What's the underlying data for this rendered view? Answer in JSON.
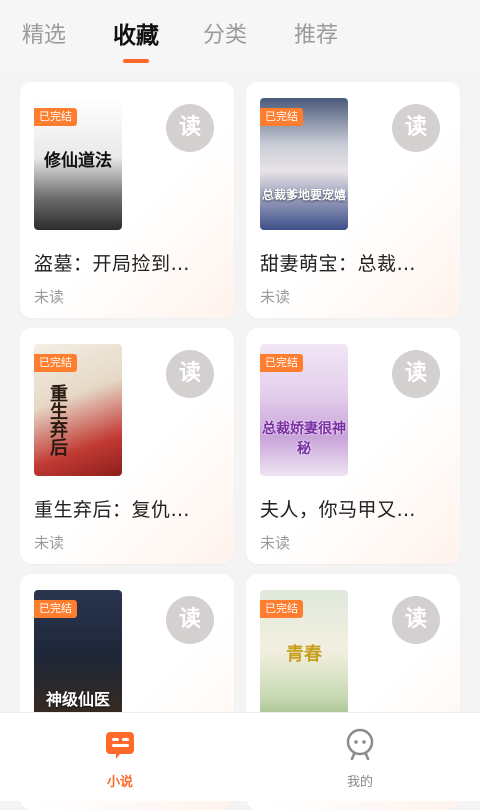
{
  "tabs": [
    {
      "label": "精选"
    },
    {
      "label": "收藏"
    },
    {
      "label": "分类"
    },
    {
      "label": "推荐"
    }
  ],
  "read_label": "读",
  "badge_label": "已完结",
  "books": [
    {
      "title": "盗墓：开局捡到…",
      "status": "未读",
      "cover_text": "修仙道法"
    },
    {
      "title": "甜妻萌宝：总裁…",
      "status": "未读",
      "cover_text": "总裁爹地要宠嬉"
    },
    {
      "title": "重生弃后：复仇…",
      "status": "未读",
      "cover_text": "重生弃后"
    },
    {
      "title": "夫人，你马甲又…",
      "status": "未读",
      "cover_text": "总裁娇妻很神秘"
    },
    {
      "title": "",
      "status": "",
      "cover_text": "神级仙医"
    },
    {
      "title": "",
      "status": "",
      "cover_text": "青春"
    }
  ],
  "nav": [
    {
      "label": "小说",
      "icon": "book-icon"
    },
    {
      "label": "我的",
      "icon": "profile-icon"
    }
  ],
  "colors": {
    "accent": "#ff6a2a",
    "badge": "#ff7d2e",
    "read_button": "#d3d0cf"
  }
}
